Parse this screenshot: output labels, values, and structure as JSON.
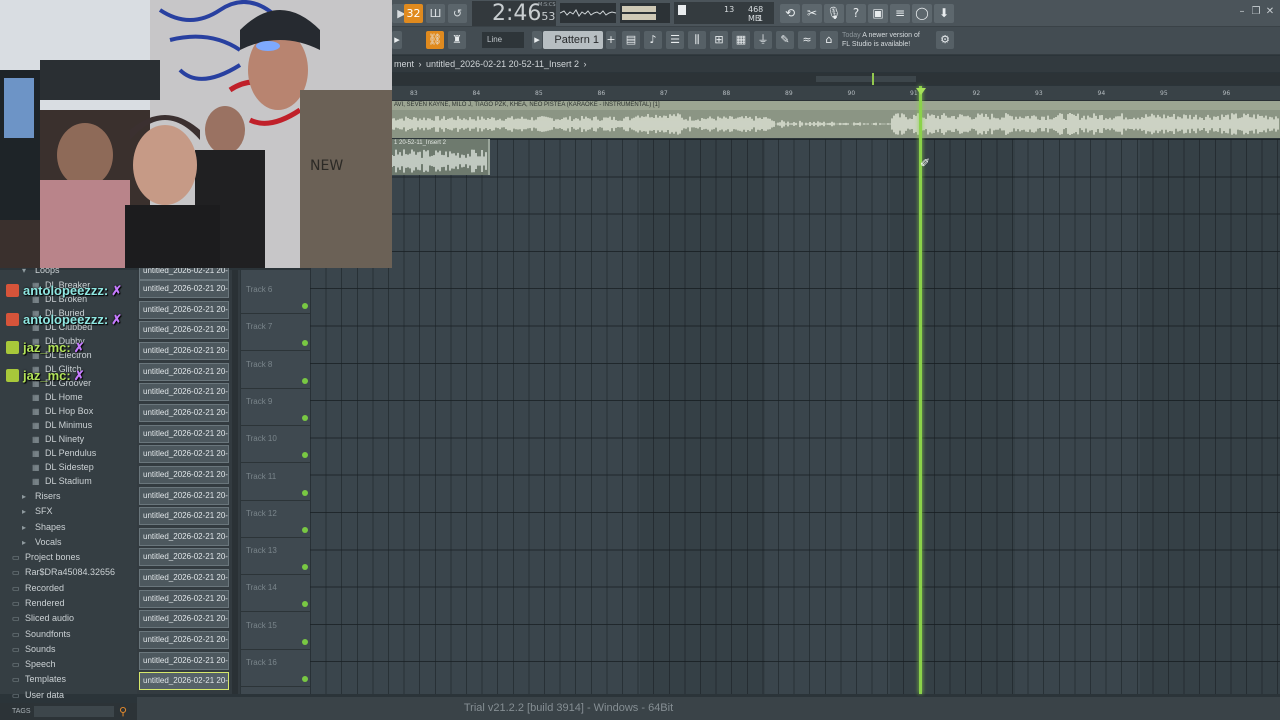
{
  "transport": {
    "time_main": "2:46",
    "time_sub": "53",
    "time_unit": "M:S:CS",
    "tempo_btn": "32",
    "cpu_value": "13",
    "mem_value": "468 MB",
    "mem_sub": "1"
  },
  "toolbar2": {
    "snap_label": "Line",
    "pattern_label": "Pattern 1",
    "news_line1": "Today",
    "news_line2": "A newer version of",
    "news_line3": "FL Studio is available!"
  },
  "breadcrumb": {
    "prefix": "ment",
    "separator": "›",
    "item": "untitled_2026-02-21 20-52-11_Insert 2",
    "end": "›"
  },
  "ruler_ticks": [
    "83",
    "84",
    "85",
    "86",
    "87",
    "88",
    "89",
    "90",
    "91",
    "92",
    "93",
    "94",
    "95",
    "96"
  ],
  "audio_clip_title": "AVI, SEVEN KAYNE, MILO J, TIAGO PZK, KHEA, NEO PISTEA (KARAOKE - INSTRUMENTAL) [1]",
  "insert_clip_title": "1 20-52-11_Insert 2",
  "tracks": [
    "Track 6",
    "Track 7",
    "Track 8",
    "Track 9",
    "Track 10",
    "Track 11",
    "Track 12",
    "Track 13",
    "Track 14",
    "Track 15",
    "Track 16"
  ],
  "clip_items": [
    "untitled_2026-02-21 20-",
    "untitled_2026-02-21 20-",
    "untitled_2026-02-21 20-",
    "untitled_2026-02-21 20-",
    "untitled_2026-02-21 20-",
    "untitled_2026-02-21 20-",
    "untitled_2026-02-21 20-",
    "untitled_2026-02-21 20-",
    "untitled_2026-02-21 20-",
    "untitled_2026-02-21 20-",
    "untitled_2026-02-21 20-",
    "untitled_2026-02-21 20-",
    "untitled_2026-02-21 20-",
    "untitled_2026-02-21 20-",
    "untitled_2026-02-21 20-",
    "untitled_2026-02-21 20-",
    "untitled_2026-02-21 20-",
    "untitled_2026-02-21 20-",
    "untitled_2026-02-21 20-",
    "untitled_2026-02-21 20-"
  ],
  "browser": {
    "loops_label": "Loops",
    "dl_items": [
      "DL Breaker",
      "DL Broken",
      "DL Buried",
      "DL Clubbed",
      "DL Dubby",
      "DL Electron",
      "DL Glitch",
      "DL Groover",
      "DL Home",
      "DL Hop Box",
      "DL Minimus",
      "DL Ninety",
      "DL Pendulus",
      "DL Sidestep",
      "DL Stadium"
    ],
    "sub_items": [
      "Risers",
      "SFX",
      "Shapes",
      "Vocals"
    ],
    "root_items": [
      "Project bones",
      "Rar$DRa45084.32656",
      "Recorded",
      "Rendered",
      "Sliced audio",
      "Soundfonts",
      "Sounds",
      "Speech",
      "Templates",
      "User data"
    ]
  },
  "chat": [
    {
      "user": "antolopeezzz:",
      "color": "#8fe7e2"
    },
    {
      "user": "antolopeezzz:",
      "color": "#8fe7e2"
    },
    {
      "user": "jaz_mc:",
      "color": "#b2e35a"
    },
    {
      "user": "jaz_mc:",
      "color": "#b2e35a"
    }
  ],
  "tags_label": "TAGS",
  "status_text": "Trial v21.2.2 [build 3914] - Windows - 64Bit",
  "colors": {
    "accent_orange": "#e08a1e",
    "playhead_green": "#8bd24a",
    "waveform": "#e8ecdf"
  },
  "icons": [
    "play-icon",
    "record-icon",
    "link-icon",
    "pattern-mode-icon",
    "undo-icon",
    "cut-icon",
    "mic-icon",
    "help-icon",
    "save-icon",
    "mixer-icon",
    "chat-icon",
    "download-icon",
    "minimize-icon",
    "maximize-icon",
    "close-icon"
  ]
}
